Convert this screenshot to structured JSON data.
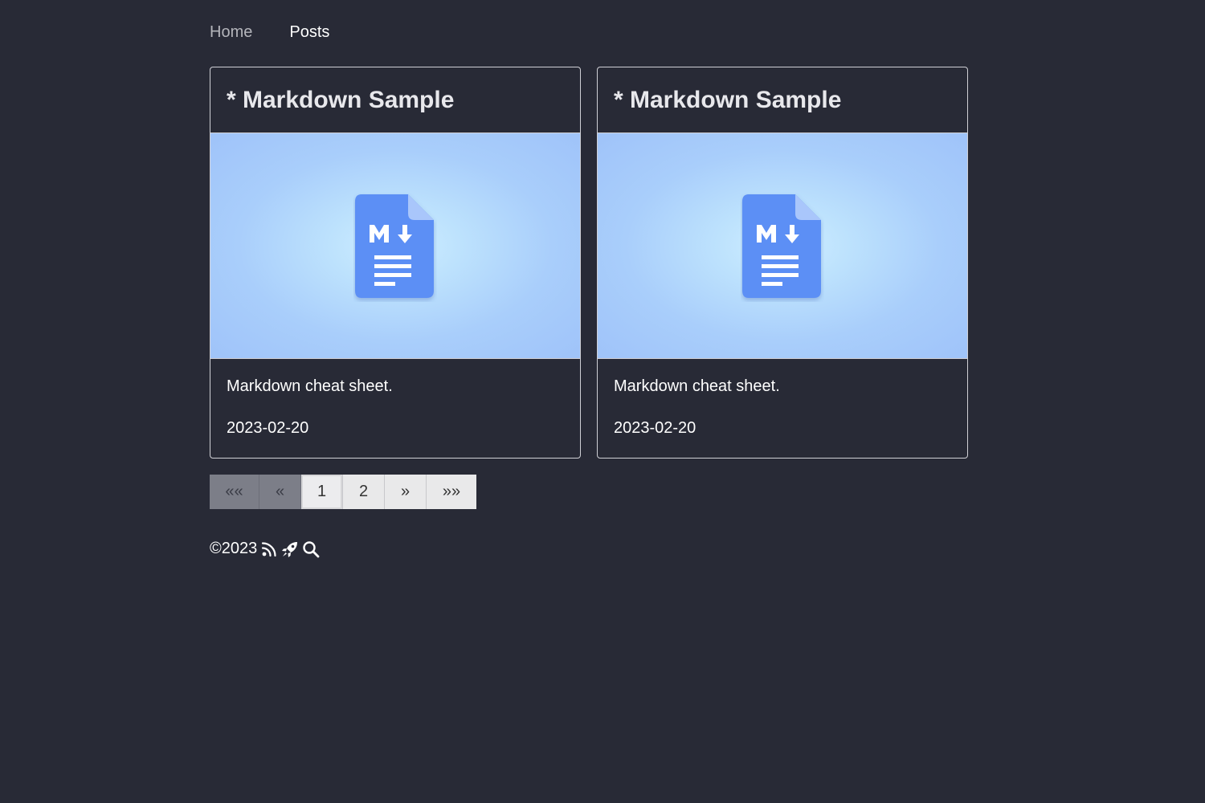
{
  "nav": {
    "items": [
      {
        "label": "Home",
        "active": false
      },
      {
        "label": "Posts",
        "active": true
      }
    ]
  },
  "cards": [
    {
      "title": "* Markdown Sample",
      "image_icon": "markdown-file-icon",
      "description": "Markdown cheat sheet.",
      "date": "2023-02-20"
    },
    {
      "title": "* Markdown Sample",
      "image_icon": "markdown-file-icon",
      "description": "Markdown cheat sheet.",
      "date": "2023-02-20"
    }
  ],
  "pagination": {
    "first": "««",
    "prev": "«",
    "pages": [
      "1",
      "2"
    ],
    "current": "1",
    "next": "»",
    "last": "»»"
  },
  "footer": {
    "copyright": "©2023",
    "icons": [
      "rss-icon",
      "rocket-icon",
      "search-icon"
    ]
  },
  "colors": {
    "background": "#282a36",
    "card_border": "#d0d0d6",
    "icon_blue": "#5b8ff5"
  }
}
